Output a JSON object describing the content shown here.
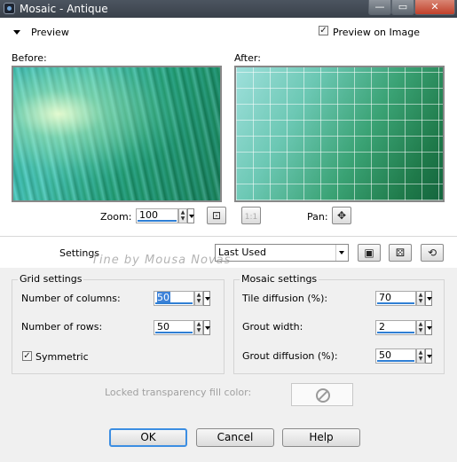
{
  "window": {
    "title": "Mosaic - Antique",
    "minimize_glyph": "—",
    "maximize_glyph": "▭",
    "close_glyph": "✕"
  },
  "preview": {
    "section_label": "Preview",
    "preview_on_image_label": "Preview on Image",
    "preview_on_image_checked": true,
    "before_label": "Before:",
    "after_label": "After:",
    "zoom_label": "Zoom:",
    "zoom_value": "100",
    "pan_label": "Pan:"
  },
  "settings": {
    "label": "Settings",
    "preset_value": "Last Used",
    "watermark_text": "Tine by Mousa Novas"
  },
  "grid_settings": {
    "title": "Grid settings",
    "columns_label": "Number of columns:",
    "columns_value": "50",
    "rows_label": "Number of rows:",
    "rows_value": "50",
    "symmetric_label": "Symmetric",
    "symmetric_checked": true
  },
  "mosaic_settings": {
    "title": "Mosaic settings",
    "tile_diffusion_label": "Tile diffusion (%):",
    "tile_diffusion_value": "70",
    "grout_width_label": "Grout width:",
    "grout_width_value": "2",
    "grout_diffusion_label": "Grout diffusion (%):",
    "grout_diffusion_value": "50"
  },
  "transparency": {
    "label": "Locked transparency fill color:"
  },
  "buttons": {
    "ok": "OK",
    "cancel": "Cancel",
    "help": "Help"
  },
  "icons": {
    "zoom_fit": "zoom-fit-icon",
    "zoom_one": "zoom-1to1-icon",
    "pan": "pan-move-icon",
    "save_preset": "save-preset-icon",
    "randomize": "dice-icon",
    "reset": "reset-icon"
  },
  "colors": {
    "titlebar": "#3f4750",
    "accent": "#2f7fd4",
    "default_button_border": "#3c8ee2"
  }
}
